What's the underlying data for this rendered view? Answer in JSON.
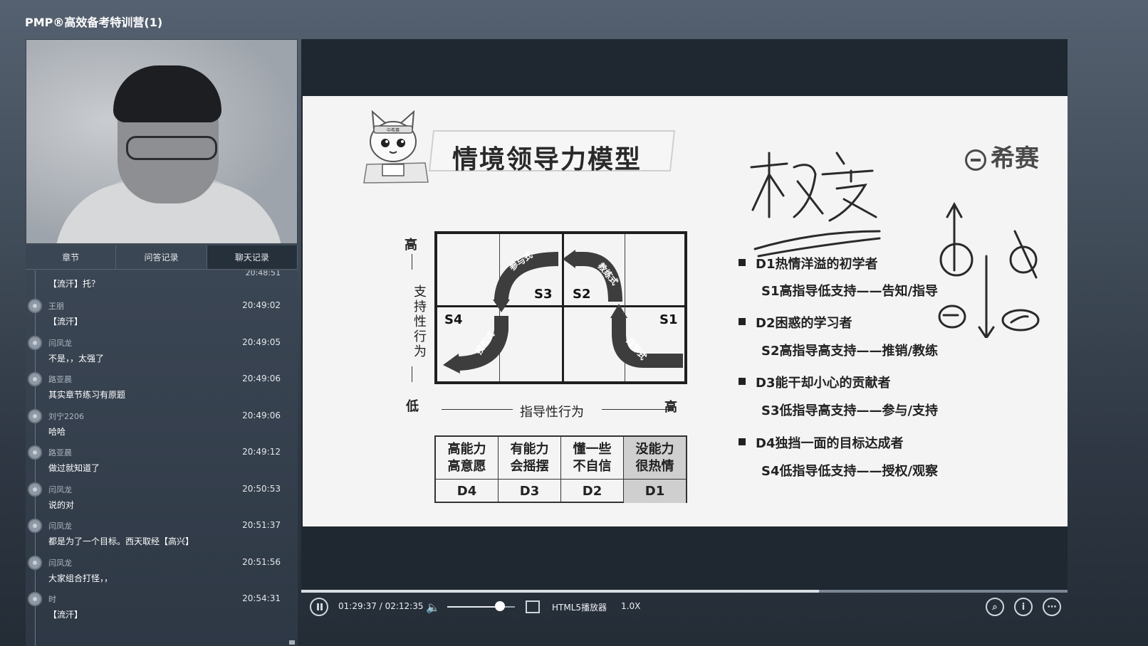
{
  "app": {
    "title": "PMP®高效备考特训营(1)"
  },
  "tabs": [
    {
      "label": "章节"
    },
    {
      "label": "问答记录"
    },
    {
      "label": "聊天记录"
    }
  ],
  "chat": {
    "partial": {
      "time": "20:48:51",
      "text": "【流汗】托？"
    },
    "messages": [
      {
        "user": "王朋",
        "time": "20:49:02",
        "text": "【流汗】"
      },
      {
        "user": "闫凤龙",
        "time": "20:49:05",
        "text": "不是，，太强了"
      },
      {
        "user": "路亚晨",
        "time": "20:49:06",
        "text": "其实章节练习有原题"
      },
      {
        "user": "刘宁2206",
        "time": "20:49:06",
        "text": "哈哈"
      },
      {
        "user": "路亚晨",
        "time": "20:49:12",
        "text": "做过就知道了"
      },
      {
        "user": "闫凤龙",
        "time": "20:50:53",
        "text": "说的对"
      },
      {
        "user": "闫凤龙",
        "time": "20:51:37",
        "text": "都是为了一个目标。西天取经【高兴】"
      },
      {
        "user": "闫凤龙",
        "time": "20:51:56",
        "text": "大家组合打怪，，"
      },
      {
        "user": "时",
        "time": "20:54:31",
        "text": "【流汗】"
      }
    ]
  },
  "slide": {
    "title": "情境领导力模型",
    "brand": "希赛",
    "mascot_text": "中希赛",
    "axis": {
      "y_high": "高",
      "y_low": "低",
      "y_label": "支持性行为",
      "x_label": "指导性行为",
      "x_high": "高"
    },
    "quadrants": [
      "S3",
      "S2",
      "S4",
      "S1"
    ],
    "curve_labels": [
      "参与式",
      "教练式",
      "授权式",
      "指导式"
    ],
    "dev_levels": [
      {
        "line1": "高能力",
        "line2": "高意愿",
        "code": "D4"
      },
      {
        "line1": "有能力",
        "line2": "会摇摆",
        "code": "D3"
      },
      {
        "line1": "懂一些",
        "line2": "不自信",
        "code": "D2"
      },
      {
        "line1": "没能力",
        "line2": "很热情",
        "code": "D1"
      }
    ],
    "list": [
      {
        "head": "D1热情洋溢的初学者",
        "sub": "S1高指导低支持——告知/指导"
      },
      {
        "head": "D2困惑的学习者",
        "sub": "S2高指导高支持——推销/教练"
      },
      {
        "head": "D3能干却小心的贡献者",
        "sub": "S3低指导高支持——参与/支持"
      },
      {
        "head": "D4独挡一面的目标达成者",
        "sub": "S4低指导低支持——授权/观察"
      }
    ],
    "handwriting": "权变"
  },
  "player": {
    "time": "01:29:37 / 02:12:35",
    "progress": 0.676,
    "volume": 0.78,
    "player_name": "HTML5播放器",
    "speed": "1.0X"
  },
  "colors": {
    "accent_dark": "#3a3a3a",
    "panel": "#2e3845"
  }
}
